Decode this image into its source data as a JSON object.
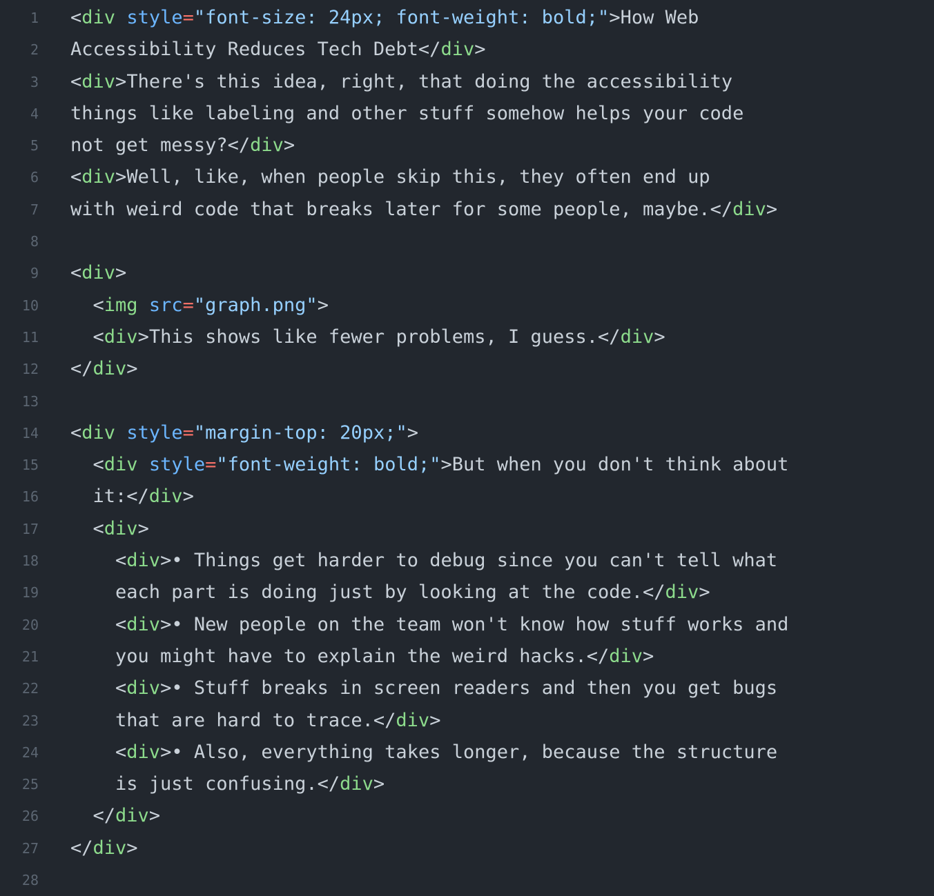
{
  "editor": {
    "lines": [
      {
        "number": "1",
        "segments": [
          {
            "t": "<",
            "c": "pun"
          },
          {
            "t": "div",
            "c": "tag"
          },
          {
            "t": " ",
            "c": "txt"
          },
          {
            "t": "style",
            "c": "attr"
          },
          {
            "t": "=",
            "c": "eq"
          },
          {
            "t": "\"font-size: 24px; font-weight: bold;\"",
            "c": "str"
          },
          {
            "t": ">How Web",
            "c": "txt"
          }
        ]
      },
      {
        "number": "2",
        "segments": [
          {
            "t": "Accessibility Reduces Tech Debt",
            "c": "txt"
          },
          {
            "t": "</",
            "c": "pun"
          },
          {
            "t": "div",
            "c": "tag"
          },
          {
            "t": ">",
            "c": "pun"
          }
        ]
      },
      {
        "number": "3",
        "segments": [
          {
            "t": "<",
            "c": "pun"
          },
          {
            "t": "div",
            "c": "tag"
          },
          {
            "t": ">",
            "c": "pun"
          },
          {
            "t": "There's this idea, right, that doing the accessibility",
            "c": "txt"
          }
        ]
      },
      {
        "number": "4",
        "segments": [
          {
            "t": "things like labeling and other stuff somehow helps your code",
            "c": "txt"
          }
        ]
      },
      {
        "number": "5",
        "segments": [
          {
            "t": "not get messy?",
            "c": "txt"
          },
          {
            "t": "</",
            "c": "pun"
          },
          {
            "t": "div",
            "c": "tag"
          },
          {
            "t": ">",
            "c": "pun"
          }
        ]
      },
      {
        "number": "6",
        "segments": [
          {
            "t": "<",
            "c": "pun"
          },
          {
            "t": "div",
            "c": "tag"
          },
          {
            "t": ">",
            "c": "pun"
          },
          {
            "t": "Well, like, when people skip this, they often end up",
            "c": "txt"
          }
        ]
      },
      {
        "number": "7",
        "segments": [
          {
            "t": "with weird code that breaks later for some people, maybe.",
            "c": "txt"
          },
          {
            "t": "</",
            "c": "pun"
          },
          {
            "t": "div",
            "c": "tag"
          },
          {
            "t": ">",
            "c": "pun"
          }
        ]
      },
      {
        "number": "8",
        "segments": []
      },
      {
        "number": "9",
        "segments": [
          {
            "t": "<",
            "c": "pun"
          },
          {
            "t": "div",
            "c": "tag"
          },
          {
            "t": ">",
            "c": "pun"
          }
        ]
      },
      {
        "number": "10",
        "segments": [
          {
            "t": "  <",
            "c": "pun"
          },
          {
            "t": "img",
            "c": "tag"
          },
          {
            "t": " ",
            "c": "txt"
          },
          {
            "t": "src",
            "c": "attr"
          },
          {
            "t": "=",
            "c": "eq"
          },
          {
            "t": "\"graph.png\"",
            "c": "str"
          },
          {
            "t": ">",
            "c": "pun"
          }
        ]
      },
      {
        "number": "11",
        "segments": [
          {
            "t": "  <",
            "c": "pun"
          },
          {
            "t": "div",
            "c": "tag"
          },
          {
            "t": ">",
            "c": "pun"
          },
          {
            "t": "This shows like fewer problems, I guess.",
            "c": "txt"
          },
          {
            "t": "</",
            "c": "pun"
          },
          {
            "t": "div",
            "c": "tag"
          },
          {
            "t": ">",
            "c": "pun"
          }
        ]
      },
      {
        "number": "12",
        "segments": [
          {
            "t": "</",
            "c": "pun"
          },
          {
            "t": "div",
            "c": "tag"
          },
          {
            "t": ">",
            "c": "pun"
          }
        ]
      },
      {
        "number": "13",
        "segments": []
      },
      {
        "number": "14",
        "segments": [
          {
            "t": "<",
            "c": "pun"
          },
          {
            "t": "div",
            "c": "tag"
          },
          {
            "t": " ",
            "c": "txt"
          },
          {
            "t": "style",
            "c": "attr"
          },
          {
            "t": "=",
            "c": "eq"
          },
          {
            "t": "\"margin-top: 20px;\"",
            "c": "str"
          },
          {
            "t": ">",
            "c": "pun"
          }
        ]
      },
      {
        "number": "15",
        "segments": [
          {
            "t": "  <",
            "c": "pun"
          },
          {
            "t": "div",
            "c": "tag"
          },
          {
            "t": " ",
            "c": "txt"
          },
          {
            "t": "style",
            "c": "attr"
          },
          {
            "t": "=",
            "c": "eq"
          },
          {
            "t": "\"font-weight: bold;\"",
            "c": "str"
          },
          {
            "t": ">But when you don't think about",
            "c": "txt"
          }
        ]
      },
      {
        "number": "16",
        "segments": [
          {
            "t": "  it:",
            "c": "txt"
          },
          {
            "t": "</",
            "c": "pun"
          },
          {
            "t": "div",
            "c": "tag"
          },
          {
            "t": ">",
            "c": "pun"
          }
        ]
      },
      {
        "number": "17",
        "segments": [
          {
            "t": "  <",
            "c": "pun"
          },
          {
            "t": "div",
            "c": "tag"
          },
          {
            "t": ">",
            "c": "pun"
          }
        ]
      },
      {
        "number": "18",
        "segments": [
          {
            "t": "    <",
            "c": "pun"
          },
          {
            "t": "div",
            "c": "tag"
          },
          {
            "t": ">",
            "c": "pun"
          },
          {
            "t": "• Things get harder to debug since you can't tell what",
            "c": "txt"
          }
        ]
      },
      {
        "number": "19",
        "segments": [
          {
            "t": "    each part is doing just by looking at the code.",
            "c": "txt"
          },
          {
            "t": "</",
            "c": "pun"
          },
          {
            "t": "div",
            "c": "tag"
          },
          {
            "t": ">",
            "c": "pun"
          }
        ]
      },
      {
        "number": "20",
        "segments": [
          {
            "t": "    <",
            "c": "pun"
          },
          {
            "t": "div",
            "c": "tag"
          },
          {
            "t": ">",
            "c": "pun"
          },
          {
            "t": "• New people on the team won't know how stuff works and",
            "c": "txt"
          }
        ]
      },
      {
        "number": "21",
        "segments": [
          {
            "t": "    you might have to explain the weird hacks.",
            "c": "txt"
          },
          {
            "t": "</",
            "c": "pun"
          },
          {
            "t": "div",
            "c": "tag"
          },
          {
            "t": ">",
            "c": "pun"
          }
        ]
      },
      {
        "number": "22",
        "segments": [
          {
            "t": "    <",
            "c": "pun"
          },
          {
            "t": "div",
            "c": "tag"
          },
          {
            "t": ">",
            "c": "pun"
          },
          {
            "t": "• Stuff breaks in screen readers and then you get bugs",
            "c": "txt"
          }
        ]
      },
      {
        "number": "23",
        "segments": [
          {
            "t": "    that are hard to trace.",
            "c": "txt"
          },
          {
            "t": "</",
            "c": "pun"
          },
          {
            "t": "div",
            "c": "tag"
          },
          {
            "t": ">",
            "c": "pun"
          }
        ]
      },
      {
        "number": "24",
        "segments": [
          {
            "t": "    <",
            "c": "pun"
          },
          {
            "t": "div",
            "c": "tag"
          },
          {
            "t": ">",
            "c": "pun"
          },
          {
            "t": "• Also, everything takes longer, because the structure",
            "c": "txt"
          }
        ]
      },
      {
        "number": "25",
        "segments": [
          {
            "t": "    is just confusing.",
            "c": "txt"
          },
          {
            "t": "</",
            "c": "pun"
          },
          {
            "t": "div",
            "c": "tag"
          },
          {
            "t": ">",
            "c": "pun"
          }
        ]
      },
      {
        "number": "26",
        "segments": [
          {
            "t": "  </",
            "c": "pun"
          },
          {
            "t": "div",
            "c": "tag"
          },
          {
            "t": ">",
            "c": "pun"
          }
        ]
      },
      {
        "number": "27",
        "segments": [
          {
            "t": "</",
            "c": "pun"
          },
          {
            "t": "div",
            "c": "tag"
          },
          {
            "t": ">",
            "c": "pun"
          }
        ]
      },
      {
        "number": "28",
        "segments": []
      }
    ]
  },
  "colors": {
    "background": "#22272e",
    "line_number": "#5c6672",
    "tag": "#8ddb8c",
    "attribute": "#6cb6ff",
    "string": "#96d0ff",
    "operator": "#f47067",
    "text": "#c9d1d9"
  }
}
